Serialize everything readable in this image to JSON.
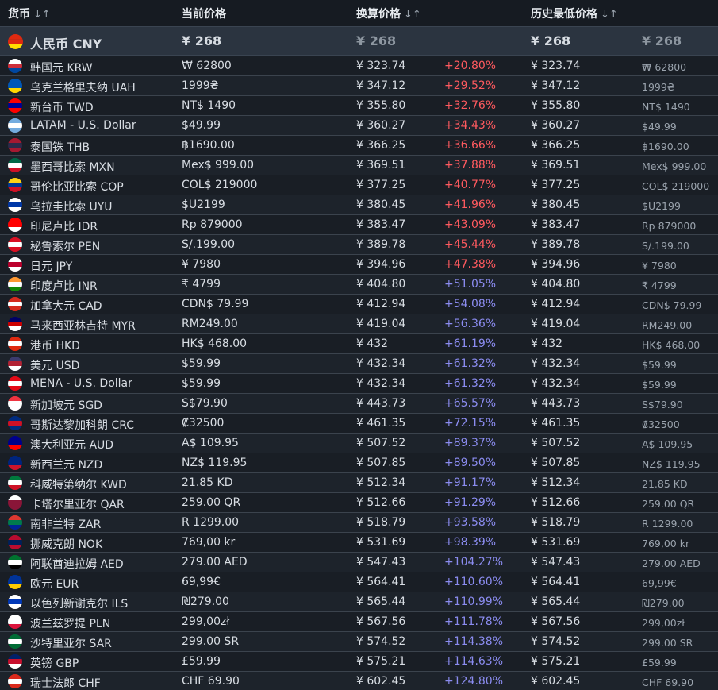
{
  "headers": {
    "currency": "货币",
    "current_price": "当前价格",
    "converted_price": "换算价格",
    "lowest_price": "历史最低价格",
    "sort_glyph": "↓↑"
  },
  "base": {
    "name": "人民币 CNY",
    "price": "¥ 268",
    "converted": "¥ 268",
    "lowest": "¥ 268",
    "lowest_alt": "¥ 268",
    "flag": [
      "#de2910",
      "#de2910",
      "#ffde00"
    ]
  },
  "rows": [
    {
      "name": "韩国元 KRW",
      "price": "₩ 62800",
      "conv": "¥ 323.74",
      "pct": "+20.80%",
      "low": "¥ 323.74",
      "low_alt": "₩ 62800",
      "flag": [
        "#ffffff",
        "#cd2e3a",
        "#0047a0"
      ],
      "tone": "red"
    },
    {
      "name": "乌克兰格里夫纳 UAH",
      "price": "1999₴",
      "conv": "¥ 347.12",
      "pct": "+29.52%",
      "low": "¥ 347.12",
      "low_alt": "1999₴",
      "flag": [
        "#0057b7",
        "#0057b7",
        "#ffd700"
      ],
      "tone": "red"
    },
    {
      "name": "新台币 TWD",
      "price": "NT$ 1490",
      "conv": "¥ 355.80",
      "pct": "+32.76%",
      "low": "¥ 355.80",
      "low_alt": "NT$ 1490",
      "flag": [
        "#fe0000",
        "#000095",
        "#fe0000"
      ],
      "tone": "red"
    },
    {
      "name": "LATAM - U.S. Dollar",
      "price": "$49.99",
      "conv": "¥ 360.27",
      "pct": "+34.43%",
      "low": "¥ 360.27",
      "low_alt": "$49.99",
      "flag": [
        "#74acdf",
        "#ffffff",
        "#74acdf"
      ],
      "tone": "red"
    },
    {
      "name": "泰国铢 THB",
      "price": "฿1690.00",
      "conv": "¥ 366.25",
      "pct": "+36.66%",
      "low": "¥ 366.25",
      "low_alt": "฿1690.00",
      "flag": [
        "#a51931",
        "#2d2a4a",
        "#a51931"
      ],
      "tone": "red"
    },
    {
      "name": "墨西哥比索 MXN",
      "price": "Mex$ 999.00",
      "conv": "¥ 369.51",
      "pct": "+37.88%",
      "low": "¥ 369.51",
      "low_alt": "Mex$ 999.00",
      "flag": [
        "#006847",
        "#ffffff",
        "#ce1126"
      ],
      "tone": "red"
    },
    {
      "name": "哥伦比亚比索 COP",
      "price": "COL$ 219000",
      "conv": "¥ 377.25",
      "pct": "+40.77%",
      "low": "¥ 377.25",
      "low_alt": "COL$ 219000",
      "flag": [
        "#fcd116",
        "#003893",
        "#ce1126"
      ],
      "tone": "red"
    },
    {
      "name": "乌拉圭比索 UYU",
      "price": "$U2199",
      "conv": "¥ 380.45",
      "pct": "+41.96%",
      "low": "¥ 380.45",
      "low_alt": "$U2199",
      "flag": [
        "#ffffff",
        "#0038a8",
        "#ffffff"
      ],
      "tone": "red"
    },
    {
      "name": "印尼卢比 IDR",
      "price": "Rp 879000",
      "conv": "¥ 383.47",
      "pct": "+43.09%",
      "low": "¥ 383.47",
      "low_alt": "Rp 879000",
      "flag": [
        "#ff0000",
        "#ff0000",
        "#ffffff"
      ],
      "tone": "red"
    },
    {
      "name": "秘鲁索尔 PEN",
      "price": "S/.199.00",
      "conv": "¥ 389.78",
      "pct": "+45.44%",
      "low": "¥ 389.78",
      "low_alt": "S/.199.00",
      "flag": [
        "#d91023",
        "#ffffff",
        "#d91023"
      ],
      "tone": "red"
    },
    {
      "name": "日元 JPY",
      "price": "¥ 7980",
      "conv": "¥ 394.96",
      "pct": "+47.38%",
      "low": "¥ 394.96",
      "low_alt": "¥ 7980",
      "flag": [
        "#ffffff",
        "#bc002d",
        "#ffffff"
      ],
      "tone": "red"
    },
    {
      "name": "印度卢比 INR",
      "price": "₹ 4799",
      "conv": "¥ 404.80",
      "pct": "+51.05%",
      "low": "¥ 404.80",
      "low_alt": "₹ 4799",
      "flag": [
        "#ff9933",
        "#ffffff",
        "#138808"
      ],
      "tone": "blue"
    },
    {
      "name": "加拿大元 CAD",
      "price": "CDN$ 79.99",
      "conv": "¥ 412.94",
      "pct": "+54.08%",
      "low": "¥ 412.94",
      "low_alt": "CDN$ 79.99",
      "flag": [
        "#d52b1e",
        "#ffffff",
        "#d52b1e"
      ],
      "tone": "blue"
    },
    {
      "name": "马来西亚林吉特 MYR",
      "price": "RM249.00",
      "conv": "¥ 419.04",
      "pct": "+56.36%",
      "low": "¥ 419.04",
      "low_alt": "RM249.00",
      "flag": [
        "#010066",
        "#cc0001",
        "#ffffff"
      ],
      "tone": "blue"
    },
    {
      "name": "港币 HKD",
      "price": "HK$ 468.00",
      "conv": "¥ 432",
      "pct": "+61.19%",
      "low": "¥ 432",
      "low_alt": "HK$ 468.00",
      "flag": [
        "#de2910",
        "#ffffff",
        "#de2910"
      ],
      "tone": "blue"
    },
    {
      "name": "美元 USD",
      "price": "$59.99",
      "conv": "¥ 432.34",
      "pct": "+61.32%",
      "low": "¥ 432.34",
      "low_alt": "$59.99",
      "flag": [
        "#3c3b6e",
        "#b22234",
        "#ffffff"
      ],
      "tone": "blue"
    },
    {
      "name": "MENA - U.S. Dollar",
      "price": "$59.99",
      "conv": "¥ 432.34",
      "pct": "+61.32%",
      "low": "¥ 432.34",
      "low_alt": "$59.99",
      "flag": [
        "#e30a17",
        "#ffffff",
        "#e30a17"
      ],
      "tone": "blue"
    },
    {
      "name": "新加坡元 SGD",
      "price": "S$79.90",
      "conv": "¥ 443.73",
      "pct": "+65.57%",
      "low": "¥ 443.73",
      "low_alt": "S$79.90",
      "flag": [
        "#ef3340",
        "#ffffff",
        "#ffffff"
      ],
      "tone": "blue"
    },
    {
      "name": "哥斯达黎加科朗 CRC",
      "price": "₡32500",
      "conv": "¥ 461.35",
      "pct": "+72.15%",
      "low": "¥ 461.35",
      "low_alt": "₡32500",
      "flag": [
        "#002b7f",
        "#ce1126",
        "#002b7f"
      ],
      "tone": "blue"
    },
    {
      "name": "澳大利亚元 AUD",
      "price": "A$ 109.95",
      "conv": "¥ 507.52",
      "pct": "+89.37%",
      "low": "¥ 507.52",
      "low_alt": "A$ 109.95",
      "flag": [
        "#00008b",
        "#00008b",
        "#ff0000"
      ],
      "tone": "blue"
    },
    {
      "name": "新西兰元 NZD",
      "price": "NZ$ 119.95",
      "conv": "¥ 507.85",
      "pct": "+89.50%",
      "low": "¥ 507.85",
      "low_alt": "NZ$ 119.95",
      "flag": [
        "#00247d",
        "#00247d",
        "#cc142b"
      ],
      "tone": "blue"
    },
    {
      "name": "科威特第纳尔 KWD",
      "price": "21.85 KD",
      "conv": "¥ 512.34",
      "pct": "+91.17%",
      "low": "¥ 512.34",
      "low_alt": "21.85 KD",
      "flag": [
        "#007a3d",
        "#ffffff",
        "#ce1126"
      ],
      "tone": "blue"
    },
    {
      "name": "卡塔尔里亚尔 QAR",
      "price": "259.00 QR",
      "conv": "¥ 512.66",
      "pct": "+91.29%",
      "low": "¥ 512.66",
      "low_alt": "259.00 QR",
      "flag": [
        "#ffffff",
        "#8a1538",
        "#8a1538"
      ],
      "tone": "blue"
    },
    {
      "name": "南非兰特 ZAR",
      "price": "R 1299.00",
      "conv": "¥ 518.79",
      "pct": "+93.58%",
      "low": "¥ 518.79",
      "low_alt": "R 1299.00",
      "flag": [
        "#de3831",
        "#007a4d",
        "#002395"
      ],
      "tone": "blue"
    },
    {
      "name": "挪威克朗 NOK",
      "price": "769,00 kr",
      "conv": "¥ 531.69",
      "pct": "+98.39%",
      "low": "¥ 531.69",
      "low_alt": "769,00 kr",
      "flag": [
        "#ba0c2f",
        "#00205b",
        "#ba0c2f"
      ],
      "tone": "blue"
    },
    {
      "name": "阿联酋迪拉姆 AED",
      "price": "279.00 AED",
      "conv": "¥ 547.43",
      "pct": "+104.27%",
      "low": "¥ 547.43",
      "low_alt": "279.00 AED",
      "flag": [
        "#00732f",
        "#ffffff",
        "#000000"
      ],
      "tone": "blue"
    },
    {
      "name": "欧元 EUR",
      "price": "69,99€",
      "conv": "¥ 564.41",
      "pct": "+110.60%",
      "low": "¥ 564.41",
      "low_alt": "69,99€",
      "flag": [
        "#003399",
        "#003399",
        "#ffcc00"
      ],
      "tone": "blue"
    },
    {
      "name": "以色列新谢克尔 ILS",
      "price": "₪279.00",
      "conv": "¥ 565.44",
      "pct": "+110.99%",
      "low": "¥ 565.44",
      "low_alt": "₪279.00",
      "flag": [
        "#ffffff",
        "#0038b8",
        "#ffffff"
      ],
      "tone": "blue"
    },
    {
      "name": "波兰兹罗提 PLN",
      "price": "299,00zł",
      "conv": "¥ 567.56",
      "pct": "+111.78%",
      "low": "¥ 567.56",
      "low_alt": "299,00zł",
      "flag": [
        "#ffffff",
        "#ffffff",
        "#dc143c"
      ],
      "tone": "blue"
    },
    {
      "name": "沙特里亚尔 SAR",
      "price": "299.00 SR",
      "conv": "¥ 574.52",
      "pct": "+114.38%",
      "low": "¥ 574.52",
      "low_alt": "299.00 SR",
      "flag": [
        "#006c35",
        "#ffffff",
        "#006c35"
      ],
      "tone": "blue"
    },
    {
      "name": "英镑 GBP",
      "price": "£59.99",
      "conv": "¥ 575.21",
      "pct": "+114.63%",
      "low": "¥ 575.21",
      "low_alt": "£59.99",
      "flag": [
        "#012169",
        "#c8102e",
        "#ffffff"
      ],
      "tone": "blue"
    },
    {
      "name": "瑞士法郎 CHF",
      "price": "CHF 69.90",
      "conv": "¥ 602.45",
      "pct": "+124.80%",
      "low": "¥ 602.45",
      "low_alt": "CHF 69.90",
      "flag": [
        "#da291c",
        "#ffffff",
        "#da291c"
      ],
      "tone": "blue"
    }
  ]
}
